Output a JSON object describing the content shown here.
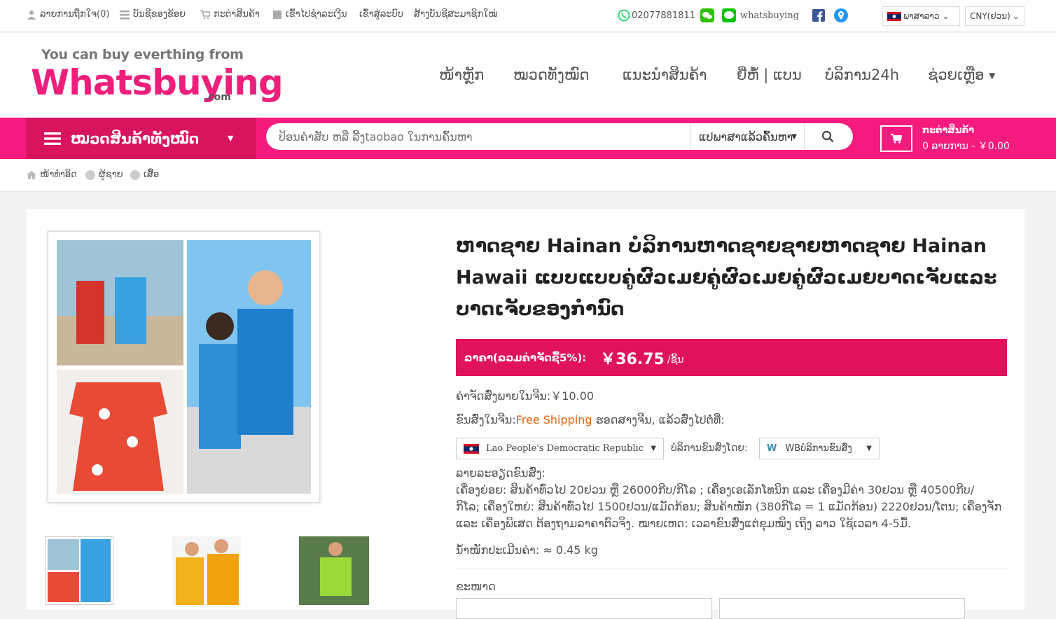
{
  "topbar": {
    "wishlist": "ລາຍການຖືກໃຈ(0)",
    "account": "ບັນຊີຂອງຂ້ອຍ",
    "cart": "ກະຕ່າສິນຄ້າ",
    "checkout": "ເຂົ້າໄປຊຳລະເງີນ",
    "login": "ເຂົ້າສູ່ລະບົບ",
    "register": "ສ້າງບັນຊີສະມາຊິກໃໝ່",
    "phone": "02077881811",
    "line_name": "whatsbuying",
    "language": "ພາສາລາວ",
    "currency": "CNY(ຢວນ)"
  },
  "logo": {
    "tagline": "You can buy everthing from",
    "name": "Whatsbuying",
    "suffix": ".com"
  },
  "nav": {
    "items": [
      "ໜ້າຫຼັກ",
      "ໝວດທັງໝົດ",
      "ແນະນຳສິນຄ້າ",
      "ຍີ່ຫໍ້ | ແບນ",
      "ບໍລິການ24h",
      "ຊ່ວຍເຫຼືອ"
    ]
  },
  "categories_label": "ໝວດສິນຄ້າທັງໝົດ",
  "search": {
    "placeholder": "ປ້ອນຄຳສັບ ຫລື ລີ້ງtaobao ໃນການຄົ້ນຫາ",
    "option": "ແປພາສາແລ້ວຄົ້ນຫາ"
  },
  "mini_cart": {
    "title": "ກະຕ່າສິນຄ້າ",
    "summary": "0 ລາຍການ - ￥0.00"
  },
  "breadcrumb": [
    "ໜ້າທຳອິດ",
    "ຜູ້ຊາຍ",
    "ເສື້ອ"
  ],
  "product": {
    "title": "ຫາດຊາຍ Hainan ບໍລິການຫາດຊາຍຊາຍຫາດຊາຍ Hainan Hawaii ແບບແບບຄູ່ຜົວເມຍຄູ່ຜົວເມຍຄູ່ຜົວເມຍບາດເຈັບແລະບາດເຈັບຂອງກຳນົດ",
    "price_label": "ລາຄາ(ລວມຄ່າຈັດຊື້5%):",
    "price": "￥36.75",
    "price_unit": "/ຊິ້ນ",
    "china_shipping": "ຄ່າຈັດສົ່ງພາຍໃນຈີນ:￥10.00",
    "ship_prefix": "ຂົນສົ່ງໃນຈີນ:",
    "ship_free": "Free Shipping",
    "ship_suffix": "ຮອດສາງຈີນ, ແລ້ວສົ່ງໄປຕໍ່ທີ່:",
    "country": "Lao People's Democratic Republic",
    "carrier_label": "ບໍລິການຂົນສົ່ງໂດຍ:",
    "carrier": "WBບໍລິການຂົນສົ່ງ",
    "desc_title": "ລາຍລະອຽດຂົນສົ່ງ:",
    "desc_line1": "ເຄື່ອງຍ່ອຍ: ສິນຄ້າທົ່ວໄປ 20ຢວນ ຫຼື 26000ກີບ/ກິໂລ ; ເຄື່ອງເອເລັກໂທນິກ ແລະ ເຄື່ອງມີຄ່າ 30ຢວນ ຫຼື 40500ກີບ/",
    "desc_line2": "ກິໂລ; ເຄື່ອງໃຫຍ່: ສິນຄ້າທົ່ວໄປ 1500ຢວນ/ແມັດກ້ອນ; ສິນຄ້າໜັກ (380ກິໂລ = 1 ແມັດກ້ອນ) 2220ຢວນ/ໂຕນ; ເຄື່ອງຈັກ",
    "desc_line3": "ແລະ ເຄື່ອງພິເສດ ຕ້ອງຖາມລາຄາຕົວຈິງ. ໝາຍເຫດ: ເວລາຂົນສົ່ງແຕ່ຂຸມໝິງ ເຖິງ ລາວ ໃຊ້ເວລາ 4-5ມື້.",
    "weight": "ນ້ຳໜັກປະເມີນຄ່າ: ≈ 0.45 kg",
    "size_label": "ຂະໜາດ"
  },
  "colors": {
    "brand_pink": "#f51a7d",
    "price_bar": "#e0125c",
    "free_shipping": "#e4600b"
  }
}
